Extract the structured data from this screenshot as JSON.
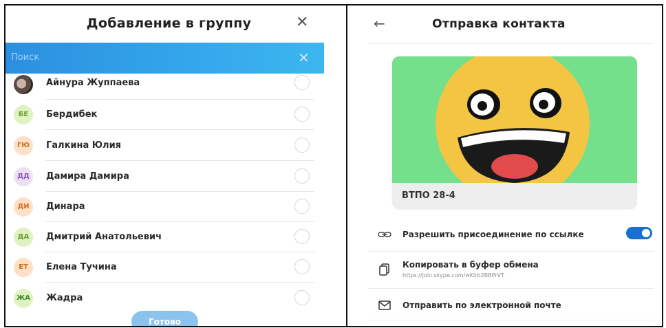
{
  "add_to_group": {
    "title": "Добавление в группу",
    "close_glyph": "✕",
    "search": {
      "placeholder": "Поиск",
      "clear_glyph": "✕"
    },
    "contacts": [
      {
        "name": "Айнура Жуппаева",
        "initials": "",
        "avatar_bg": "#cfcfcf",
        "avatar_fg": "#ffffff",
        "has_photo": true
      },
      {
        "name": "Бердибек",
        "initials": "БЕ",
        "avatar_bg": "#dff2c2",
        "avatar_fg": "#6a9a2b"
      },
      {
        "name": "Галкина Юлия",
        "initials": "ГЮ",
        "avatar_bg": "#fde0c6",
        "avatar_fg": "#d0701d"
      },
      {
        "name": "Дамира Дамира",
        "initials": "ДД",
        "avatar_bg": "#ece0f6",
        "avatar_fg": "#8b55b8"
      },
      {
        "name": "Динара",
        "initials": "ДИ",
        "avatar_bg": "#fde0c6",
        "avatar_fg": "#d0701d"
      },
      {
        "name": "Дмитрий Анатольевич",
        "initials": "ДА",
        "avatar_bg": "#dff2c2",
        "avatar_fg": "#6a9a2b"
      },
      {
        "name": "Елена Тучина",
        "initials": "ЕТ",
        "avatar_bg": "#fde0c6",
        "avatar_fg": "#d0701d"
      },
      {
        "name": "Жадра",
        "initials": "ЖА",
        "avatar_bg": "#dff2c2",
        "avatar_fg": "#3d8b2a"
      }
    ],
    "done_label": "Готово"
  },
  "send_contact": {
    "back_glyph": "←",
    "title": "Отправка контакта",
    "card": {
      "label": "ВТПО 28-4",
      "art_bg": "#74e08b"
    },
    "options": {
      "allow_link": {
        "label": "Разрешить присоединение по ссылке",
        "icon": "link-icon",
        "toggle_on": true
      },
      "copy": {
        "label": "Копировать в буфер обмена",
        "url": "https://join.skype.com/wKlrb2BBPrVT",
        "icon": "copy-icon"
      },
      "email": {
        "label": "Отправить по электронной почте",
        "icon": "mail-icon"
      }
    }
  }
}
